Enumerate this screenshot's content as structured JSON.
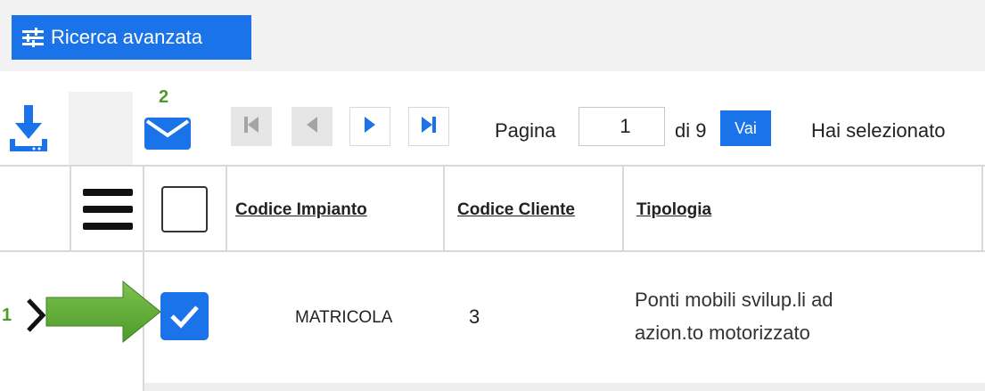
{
  "advanced_search": {
    "label": "Ricerca avanzata",
    "icon": "tune-sliders-icon"
  },
  "toolbar": {
    "download_icon": "download-icon",
    "email_icon": "envelope-icon",
    "pagination": {
      "first_icon": "first-page-icon",
      "prev_icon": "previous-page-icon",
      "next_icon": "next-page-icon",
      "last_icon": "last-page-icon",
      "page_label": "Pagina",
      "page_value": "1",
      "of_label": "di 9",
      "go_label": "Vai"
    },
    "selection_text": "Hai selezionato"
  },
  "table": {
    "menu_icon": "hamburger-menu-icon",
    "columns": [
      "Codice Impianto",
      "Codice Cliente",
      "Tipologia"
    ],
    "rows": [
      {
        "checked": true,
        "codice_impianto": "MATRICOLA",
        "codice_cliente": "3",
        "tipologia_line1": "Ponti mobili svilup.li ad",
        "tipologia_line2": "azion.to motorizzato"
      }
    ]
  },
  "annotations": {
    "step1": "1",
    "step2": "2",
    "arrow_color": "#5aa832",
    "accent_color": "#1a73e8"
  }
}
